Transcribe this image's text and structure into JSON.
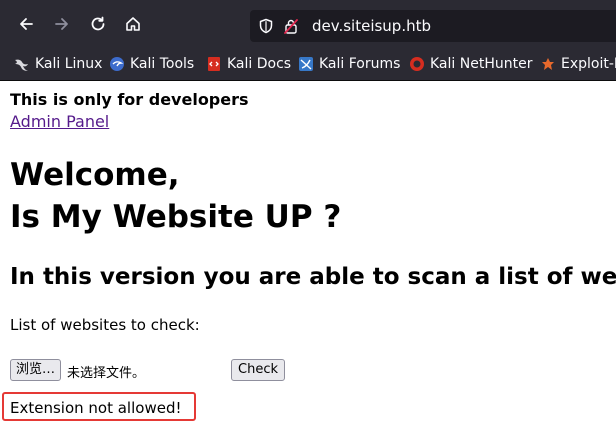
{
  "browser": {
    "url": "dev.siteisup.htb",
    "colors": {
      "chrome": "#2b2a33",
      "urlbar": "#1c1b22",
      "text": "#fbfbfe"
    },
    "nav_icons": [
      "back-arrow-icon",
      "forward-arrow-icon",
      "reload-icon",
      "home-icon"
    ],
    "bookmarks": [
      {
        "label": "Kali Linux",
        "icon": "kali-dragon-icon"
      },
      {
        "label": "Kali Tools",
        "icon": "kali-tools-icon"
      },
      {
        "label": "Kali Docs",
        "icon": "kali-docs-icon"
      },
      {
        "label": "Kali Forums",
        "icon": "kali-forums-icon"
      },
      {
        "label": "Kali NetHunter",
        "icon": "kali-nethunter-icon"
      },
      {
        "label": "Exploit-DB",
        "icon": "exploit-db-icon"
      }
    ]
  },
  "page": {
    "dev_note": "This is only for developers",
    "admin_link": "Admin Panel",
    "heading_line1": "Welcome,",
    "heading_line2": "Is My Website UP ?",
    "subheading": "In this version you are able to scan a list of websites",
    "list_label": "List of websites to check:",
    "browse_button": "浏览…",
    "file_status": "未选择文件。",
    "check_button": "Check",
    "error_message": "Extension not allowed!",
    "colors": {
      "link": "#551a8b",
      "error_border": "#e53935"
    }
  }
}
